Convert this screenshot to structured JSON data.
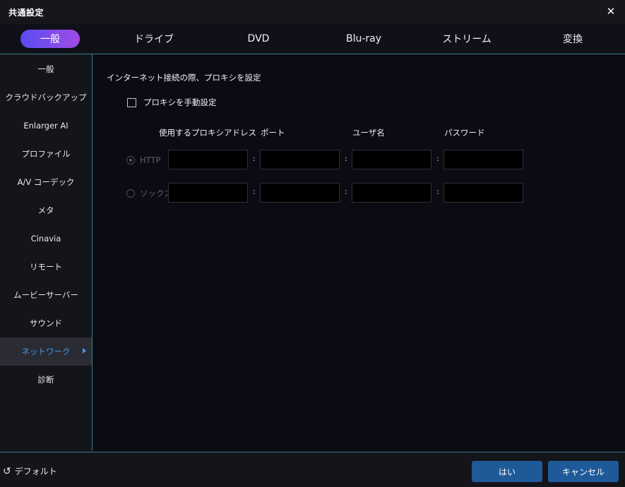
{
  "window": {
    "title": "共通設定",
    "close_icon": "close-icon"
  },
  "tabs": [
    {
      "label": "一般",
      "active": true
    },
    {
      "label": "ドライブ"
    },
    {
      "label": "DVD"
    },
    {
      "label": "Blu-ray"
    },
    {
      "label": "ストリーム"
    },
    {
      "label": "変換"
    }
  ],
  "sidebar": {
    "items": [
      {
        "label": "一般"
      },
      {
        "label": "クラウドバックアップ"
      },
      {
        "label": "Enlarger AI"
      },
      {
        "label": "プロファイル"
      },
      {
        "label": "A/V コーデック"
      },
      {
        "label": "メタ"
      },
      {
        "label": "Cinavia"
      },
      {
        "label": "リモート"
      },
      {
        "label": "ムービーサーバー"
      },
      {
        "label": "サウンド"
      },
      {
        "label": "ネットワーク",
        "active": true
      },
      {
        "label": "診断"
      }
    ]
  },
  "main": {
    "heading": "インターネット接続の際、プロキシを設定",
    "manual_proxy_label": "プロキシを手動設定",
    "manual_proxy_checked": false,
    "columns": {
      "address": "使用するプロキシアドレス",
      "port": "ポート",
      "username": "ユーザ名",
      "password": "パスワード"
    },
    "separator": ":",
    "proxies": [
      {
        "label": "HTTP",
        "selected": true,
        "address": "",
        "port": "",
        "username": "",
        "password": ""
      },
      {
        "label": "ソックス",
        "selected": false,
        "address": "",
        "port": "",
        "username": "",
        "password": ""
      }
    ]
  },
  "footer": {
    "default_label": "デフォルト",
    "default_icon": "reset-icon",
    "ok_label": "はい",
    "cancel_label": "キャンセル"
  },
  "colors": {
    "accent_blue": "#3f9cf0",
    "button_blue": "#1f5a98",
    "tab_gradient_start": "#5a4cf0",
    "tab_gradient_end": "#a04ce6"
  }
}
